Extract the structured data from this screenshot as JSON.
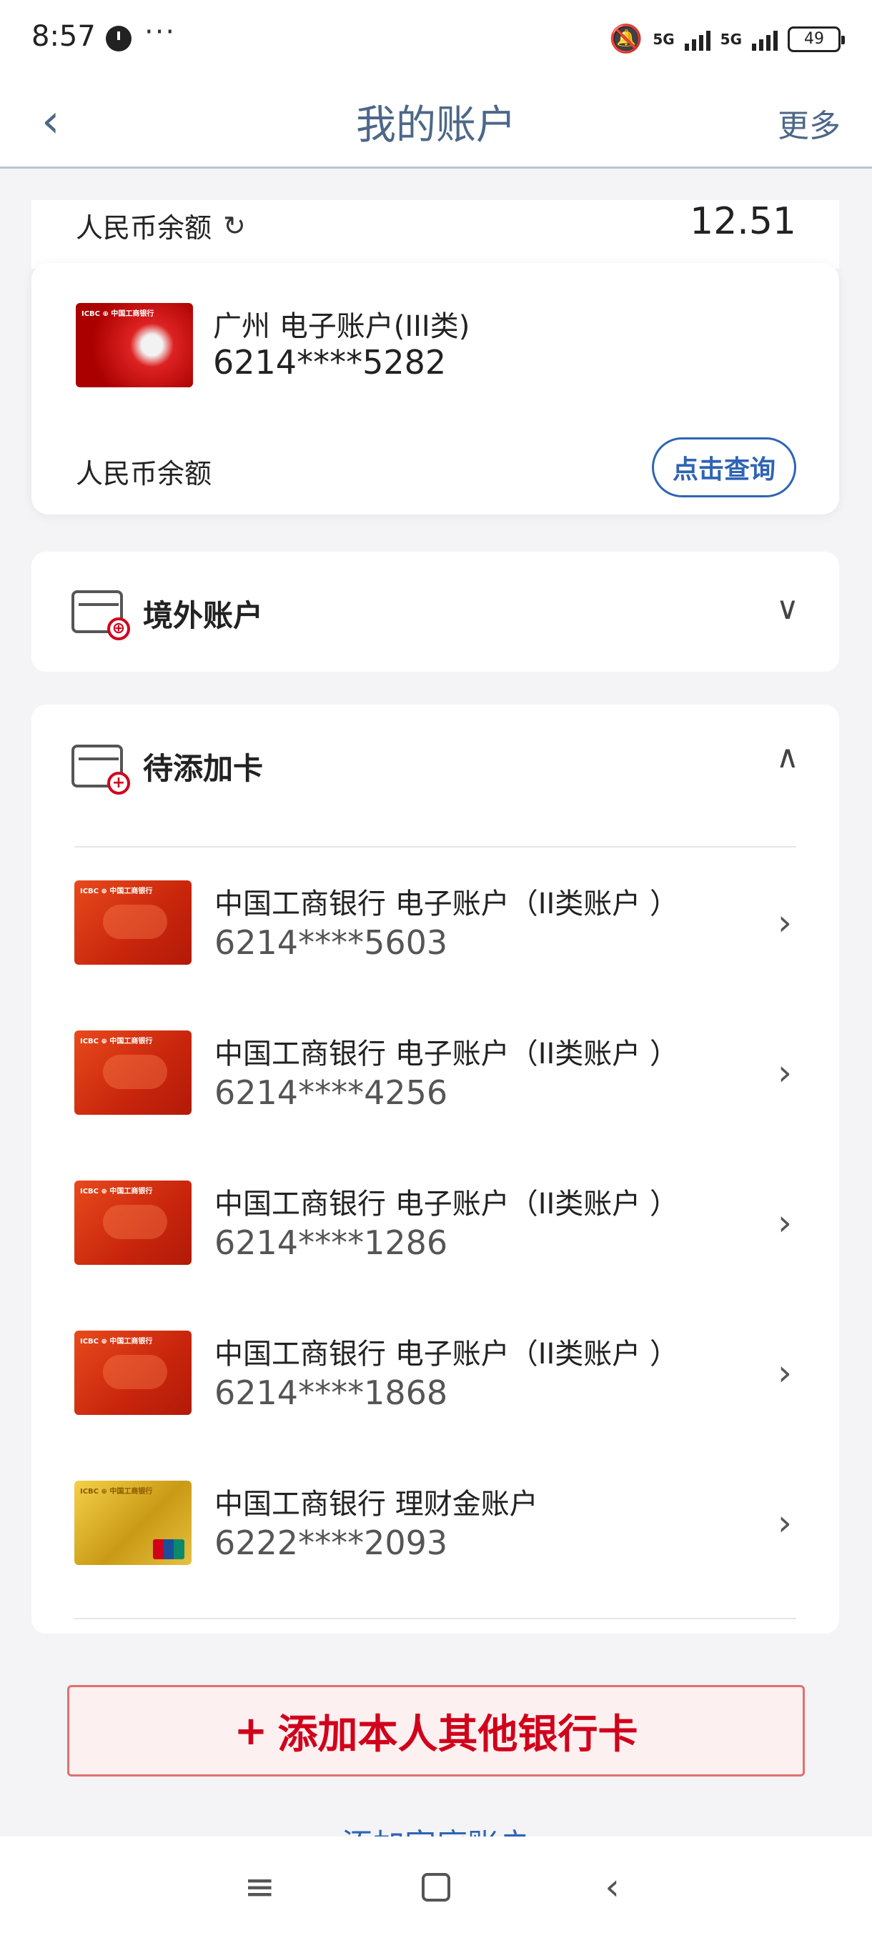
{
  "status": {
    "time": "8:57",
    "net1": "5G",
    "net2": "5G",
    "battery": "49"
  },
  "header": {
    "title": "我的账户",
    "more": "更多"
  },
  "top_balance": {
    "label": "人民币余额",
    "value": "12.51"
  },
  "main_account": {
    "name": "广州 电子账户(III类)",
    "number": "6214****5282",
    "balance_label": "人民币余额",
    "query_button": "点击查询"
  },
  "overseas": {
    "title": "境外账户"
  },
  "pending": {
    "title": "待添加卡",
    "cards": [
      {
        "name": "中国工商银行 电子账户（II类账户 ）",
        "number": "6214****5603",
        "style": "orange"
      },
      {
        "name": "中国工商银行 电子账户（II类账户 ）",
        "number": "6214****4256",
        "style": "orange"
      },
      {
        "name": "中国工商银行 电子账户（II类账户 ）",
        "number": "6214****1286",
        "style": "orange"
      },
      {
        "name": "中国工商银行 电子账户（II类账户 ）",
        "number": "6214****1868",
        "style": "orange"
      },
      {
        "name": "中国工商银行 理财金账户",
        "number": "6222****2093",
        "style": "gold"
      }
    ]
  },
  "actions": {
    "add_bank_card": "添加本人其他银行卡",
    "add_family": "添加家庭账户"
  },
  "colors": {
    "accent_blue": "#2f64b4",
    "header_text": "#4d6788",
    "brand_red": "#d0021b"
  }
}
